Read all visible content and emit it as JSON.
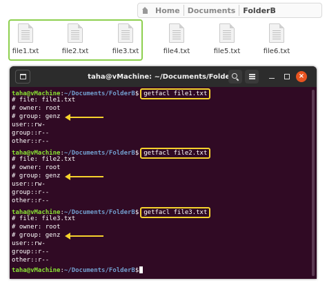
{
  "file_manager": {
    "breadcrumb": [
      {
        "label": "Home",
        "icon": "home-icon"
      },
      {
        "label": "Documents"
      },
      {
        "label": "FolderB"
      }
    ],
    "files": [
      {
        "name": "file1.txt",
        "icon": "text-file-icon"
      },
      {
        "name": "file2.txt",
        "icon": "text-file-icon"
      },
      {
        "name": "file3.txt",
        "icon": "text-file-icon"
      },
      {
        "name": "file4.txt",
        "icon": "text-file-icon"
      },
      {
        "name": "file5.txt",
        "icon": "text-file-icon"
      },
      {
        "name": "file6.txt",
        "icon": "text-file-icon"
      }
    ],
    "highlight_color": "#8ccf4d"
  },
  "terminal": {
    "title": "taha@vMachine: ~/Documents/FolderB",
    "close_glyph": "×",
    "prompt_user": "taha@vMachine",
    "prompt_sep": ":",
    "prompt_path": "~/Documents/FolderB",
    "prompt_symbol": "$",
    "blocks": [
      {
        "command": "getfacl file1.txt",
        "output": [
          "# file: file1.txt",
          "# owner: root",
          "# group: genz",
          "user::rw-",
          "group::r--",
          "other::r--"
        ]
      },
      {
        "command": "getfacl file2.txt",
        "output": [
          "# file: file2.txt",
          "# owner: root",
          "# group: genz",
          "user::rw-",
          "group::r--",
          "other::r--"
        ]
      },
      {
        "command": "getfacl file3.txt",
        "output": [
          "# file: file3.txt",
          "# owner: root",
          "# group: genz",
          "user::rw-",
          "group::r--",
          "other::r--"
        ]
      }
    ],
    "colors": {
      "background": "#300a24",
      "user": "#8ae234",
      "path": "#729fcf",
      "annotation": "#f6d32d",
      "close_button": "#e95420"
    }
  }
}
